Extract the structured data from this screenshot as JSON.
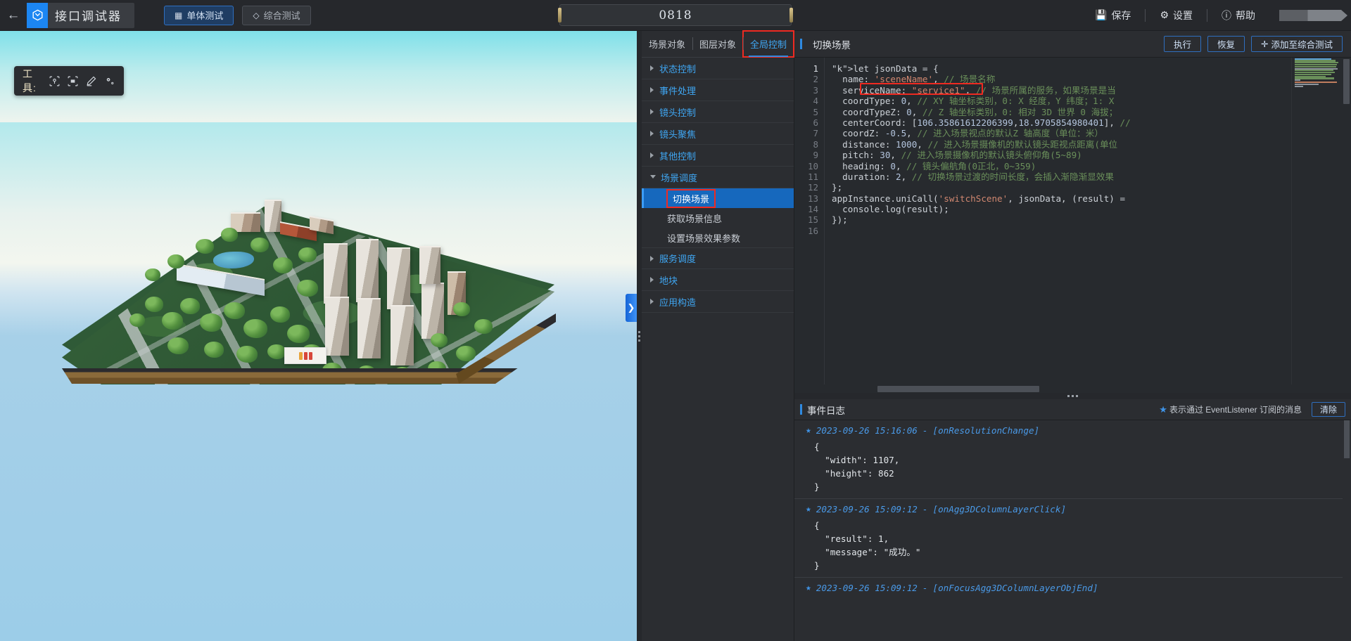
{
  "header": {
    "back_icon": "back-arrow-icon",
    "app_title": "接口调试器",
    "logo_icon": "cube-logo-icon",
    "mode_tabs": [
      {
        "label": "单体测试",
        "icon": "cube-icon",
        "active": true
      },
      {
        "label": "综合测试",
        "icon": "layers-icon",
        "active": false
      }
    ],
    "center_field_value": "0818",
    "actions": [
      {
        "label": "保存",
        "icon": "save-icon"
      },
      {
        "label": "设置",
        "icon": "gear-icon"
      },
      {
        "label": "帮助",
        "icon": "help-icon"
      }
    ]
  },
  "viewport": {
    "tools_label": "工具:",
    "tool_icons": [
      "pin-marker-icon",
      "frame-select-icon",
      "pencil-icon",
      "settings-gear-icon"
    ],
    "collapse_icon": "chevron-right-icon"
  },
  "mid_panel": {
    "tabs": [
      {
        "label": "场景对象",
        "active": false,
        "highlight": false
      },
      {
        "label": "图层对象",
        "active": false,
        "highlight": false
      },
      {
        "label": "全局控制",
        "active": true,
        "highlight": true
      }
    ],
    "groups": [
      {
        "label": "状态控制",
        "open": false,
        "children": []
      },
      {
        "label": "事件处理",
        "open": false,
        "children": []
      },
      {
        "label": "镜头控制",
        "open": false,
        "children": []
      },
      {
        "label": "镜头聚焦",
        "open": false,
        "children": []
      },
      {
        "label": "其他控制",
        "open": false,
        "children": []
      },
      {
        "label": "场景调度",
        "open": true,
        "children": [
          {
            "label": "切换场景",
            "selected": true,
            "highlight": true
          },
          {
            "label": "获取场景信息",
            "selected": false,
            "highlight": false
          },
          {
            "label": "设置场景效果参数",
            "selected": false,
            "highlight": false
          }
        ]
      },
      {
        "label": "服务调度",
        "open": false,
        "children": []
      },
      {
        "label": "地块",
        "open": false,
        "children": []
      },
      {
        "label": "应用构造",
        "open": false,
        "children": []
      }
    ]
  },
  "code_panel": {
    "title": "切换场景",
    "buttons": [
      {
        "label": "执行",
        "icon": ""
      },
      {
        "label": "恢复",
        "icon": ""
      },
      {
        "label": "添加至综合测试",
        "icon": "plus-icon"
      }
    ],
    "line_numbers": [
      "1",
      "2",
      "3",
      "4",
      "5",
      "6",
      "7",
      "8",
      "9",
      "10",
      "11",
      "12",
      "13",
      "14",
      "15",
      "16"
    ],
    "lines": [
      "let jsonData = {",
      "  name: 'sceneName', // 场景名称",
      "  serviceName: \"service1\", // 场景所属的服务，如果场景是当",
      "  coordType: 0, // XY 轴坐标类别，0: X 经度，Y 纬度；1: X",
      "  coordTypeZ: 0, // Z 轴坐标类别，0: 相对 3D 世界 0 海拔；",
      "  centerCoord: [106.35861612206399,18.9705854980401], //",
      "  coordZ: -0.5, // 进入场景视点的默认Z 轴高度（单位：米）",
      "  distance: 1000, // 进入场景摄像机的默认镜头距视点距离(单位",
      "  pitch: 30, // 进入场景摄像机的默认镜头俯仰角(5~89)",
      "  heading: 0, // 镜头偏航角(0正北，0~359)",
      "  duration: 2, // 切换场景过渡的时间长度，会插入渐隐渐显效果",
      "};",
      "appInstance.uniCall('switchScene', jsonData, (result) =",
      "  console.log(result);",
      "});",
      ""
    ]
  },
  "log_panel": {
    "title": "事件日志",
    "hint": "表示通过 EventListener 订阅的消息",
    "star_icon": "star-icon",
    "clear_label": "清除",
    "entries": [
      {
        "timestamp": "2023-09-26 15:16:06",
        "event": "[onResolutionChange]",
        "json": [
          "{",
          "  \"width\": 1107,",
          "  \"height\": 862",
          "}"
        ]
      },
      {
        "timestamp": "2023-09-26 15:09:12",
        "event": "[onAgg3DColumnLayerClick]",
        "json": [
          "{",
          "  \"result\": 1,",
          "  \"message\": \"成功。\"",
          "}"
        ]
      },
      {
        "timestamp": "2023-09-26 15:09:12",
        "event": "[onFocusAgg3DColumnLayerObjEnd]",
        "json": []
      }
    ]
  },
  "colors": {
    "accent_blue": "#2f8ae0",
    "highlight_red": "#ef2a21",
    "panel_bg": "#2b2d31",
    "editor_bg": "#272a2e",
    "selected_row": "#1668bd"
  }
}
